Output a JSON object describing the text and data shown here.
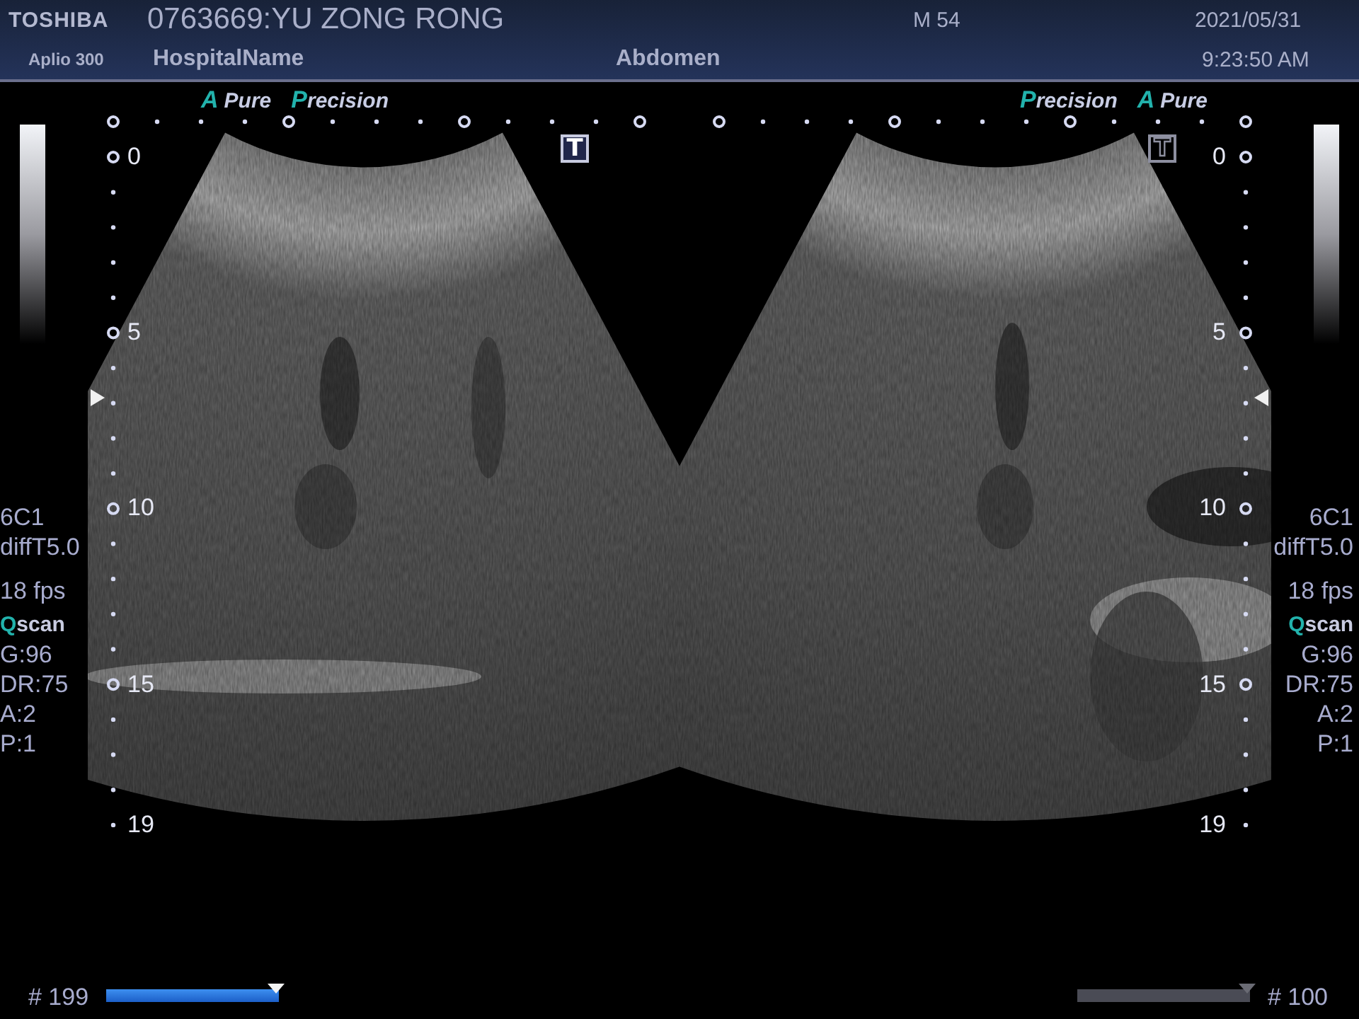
{
  "header": {
    "brand": "TOSHIBA",
    "model": "Aplio 300",
    "patient": "0763669:YU ZONG RONG",
    "hospital": "HospitalName",
    "exam": "Abdomen",
    "sex_age": "M 54",
    "date": "2021/05/31",
    "time": "9:23:50 AM"
  },
  "panes": [
    {
      "selected": true,
      "badges": [
        {
          "accent": "A",
          "text": "Pure",
          "joined": false
        },
        {
          "accent": "P",
          "text": "recision",
          "joined": true
        }
      ],
      "mode_key": "T",
      "depth_labels": [
        "0",
        "5",
        "10",
        "15",
        "19"
      ],
      "probe": "6C1",
      "filter": "diffT5.0",
      "frame_rate": "18 fps",
      "scan_mode": {
        "accent": "Q",
        "text": "scan"
      },
      "settings": [
        "G:96",
        "DR:75",
        "A:2",
        "P:1"
      ],
      "frame": "# 199",
      "level": 1
    },
    {
      "selected": false,
      "badges": [
        {
          "accent": "P",
          "text": "recision",
          "joined": true
        },
        {
          "accent": "A",
          "text": "Pure",
          "joined": false
        }
      ],
      "mode_key": "T",
      "depth_labels": [
        "0",
        "5",
        "10",
        "15",
        "19"
      ],
      "probe": "6C1",
      "filter": "diffT5.0",
      "frame_rate": "18 fps",
      "scan_mode": {
        "accent": "Q",
        "text": "scan"
      },
      "settings": [
        "G:96",
        "DR:75",
        "A:2",
        "P:1"
      ],
      "frame": "# 100",
      "level": 1
    }
  ]
}
